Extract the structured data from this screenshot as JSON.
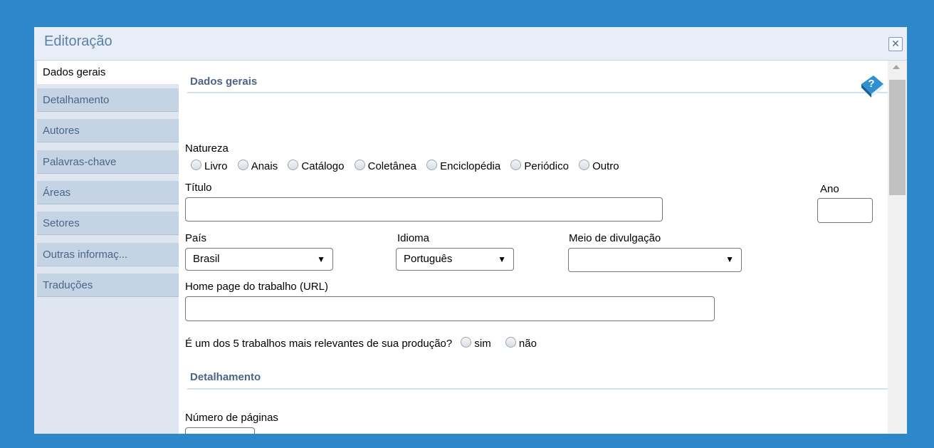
{
  "dialog": {
    "title": "Editoração"
  },
  "sidebar": {
    "tabs": [
      {
        "label": "Dados gerais"
      },
      {
        "label": "Detalhamento"
      },
      {
        "label": "Autores"
      },
      {
        "label": "Palavras-chave"
      },
      {
        "label": "Áreas"
      },
      {
        "label": "Setores"
      },
      {
        "label": "Outras informaç..."
      },
      {
        "label": "Traduções"
      }
    ],
    "active_tab": "Dados gerais"
  },
  "dados_gerais": {
    "heading": "Dados gerais",
    "natureza_label": "Natureza",
    "natureza_options": [
      "Livro",
      "Anais",
      "Catálogo",
      "Coletânea",
      "Enciclopédia",
      "Periódico",
      "Outro"
    ],
    "titulo_label": "Título",
    "titulo_value": "",
    "ano_label": "Ano",
    "ano_value": "",
    "pais_label": "País",
    "pais_value": "Brasil",
    "idioma_label": "Idioma",
    "idioma_value": "Português",
    "meio_label": "Meio de divulgação",
    "meio_value": "",
    "homepage_label": "Home page do trabalho (URL)",
    "homepage_value": "",
    "relevante_question": "É um dos 5 trabalhos mais relevantes de sua produção?",
    "relevante_options": [
      "sim",
      "não"
    ]
  },
  "detalhamento": {
    "heading": "Detalhamento",
    "paginas_label": "Número de páginas",
    "paginas_value": ""
  },
  "icons": {
    "close": "close-icon",
    "help": "help-book-icon",
    "dropdown": "triangle-down-icon"
  },
  "colors": {
    "background": "#2d87c9",
    "title": "#5b7fa6",
    "tab": "#c5d4e5",
    "section_heading": "#4a6585"
  }
}
